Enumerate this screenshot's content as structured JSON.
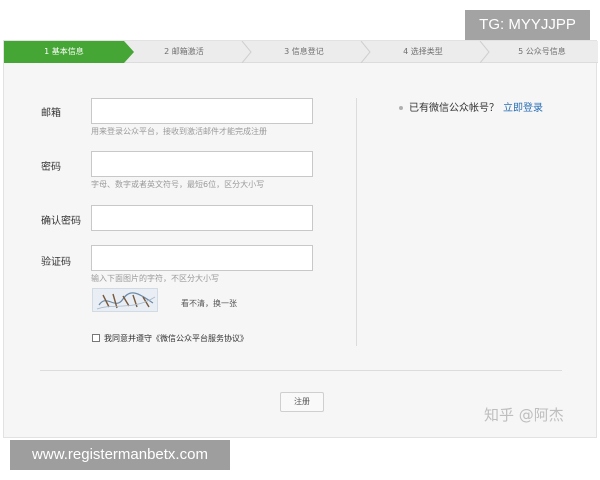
{
  "watermarks": {
    "top": "TG: MYYJJPP",
    "bottom": "www.registermanbetx.com",
    "zhihu": "知乎 @阿杰"
  },
  "steps": [
    {
      "label": "1 基本信息",
      "active": true
    },
    {
      "label": "2 邮箱激活",
      "active": false
    },
    {
      "label": "3 信息登记",
      "active": false
    },
    {
      "label": "4 选择类型",
      "active": false
    },
    {
      "label": "5 公众号信息",
      "active": false
    }
  ],
  "form": {
    "email": {
      "label": "邮箱",
      "value": "",
      "hint": "用来登录公众平台，接收到激活邮件才能完成注册"
    },
    "password": {
      "label": "密码",
      "value": "",
      "hint": "字母、数字或者英文符号，最短6位，区分大小写"
    },
    "confirm": {
      "label": "确认密码",
      "value": ""
    },
    "captcha": {
      "label": "验证码",
      "value": "",
      "hint": "输入下面图片的字符，不区分大小写",
      "refresh": "看不清，换一张"
    },
    "agree": {
      "text": "我同意并遵守",
      "link": "《微信公众平台服务协议》"
    },
    "submit": "注册"
  },
  "side": {
    "question": "已有微信公众帐号？",
    "login": "立即登录"
  },
  "colors": {
    "accent_green": "#45a635",
    "link_blue": "#2a6fb5"
  }
}
